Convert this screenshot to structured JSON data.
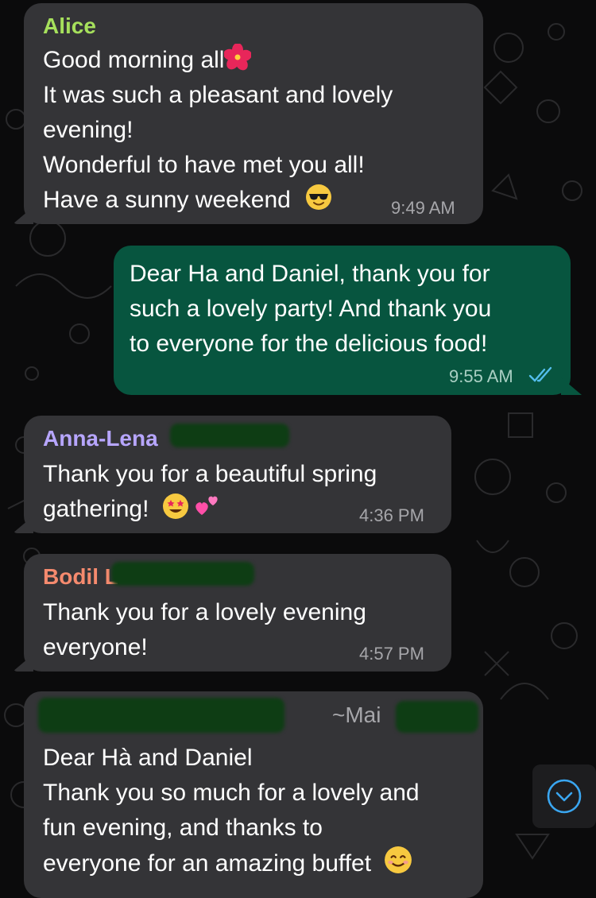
{
  "messages": [
    {
      "sender": "Alice",
      "sender_color": "#a6e05c",
      "lines": [
        "Good morning all",
        "It was such a pleasant and lovely",
        "evening!",
        "Wonderful to have met you all!",
        "Have a sunny weekend"
      ],
      "emojis": [
        "hibiscus",
        "smiling-face-with-sunglasses"
      ],
      "time": "9:49 AM"
    },
    {
      "sender": "",
      "outgoing": true,
      "lines": [
        "Dear Ha and Daniel, thank you for",
        "such a lovely party! And thank you",
        "to everyone for the delicious food!"
      ],
      "time": "9:55 AM",
      "status": "read"
    },
    {
      "sender": "Anna-Lena",
      "sender_color": "#b7a6ff",
      "lines": [
        "Thank you for a beautiful spring",
        "gathering!"
      ],
      "emojis": [
        "star-struck",
        "two-hearts"
      ],
      "time": "4:36 PM"
    },
    {
      "sender": "Bodil",
      "sender_initial_visible": "L",
      "sender_color": "#f58a6e",
      "lines": [
        "Thank you for a lovely evening",
        "everyone!"
      ],
      "time": "4:57 PM"
    },
    {
      "sender_tag": "~Mai",
      "lines": [
        "Dear Hà and Daniel",
        "Thank you so much for a lovely and",
        "fun evening, and thanks to",
        "everyone for an amazing buffet"
      ],
      "emojis": [
        "smiling-face"
      ]
    }
  ],
  "colors": {
    "incoming_bubble": "#343437",
    "outgoing_bubble": "#07553f",
    "read_ticks": "#53bdeb",
    "scroll_button_icon": "#3aa6f0"
  },
  "icons": [
    "chevron-down-icon",
    "double-check-icon"
  ]
}
